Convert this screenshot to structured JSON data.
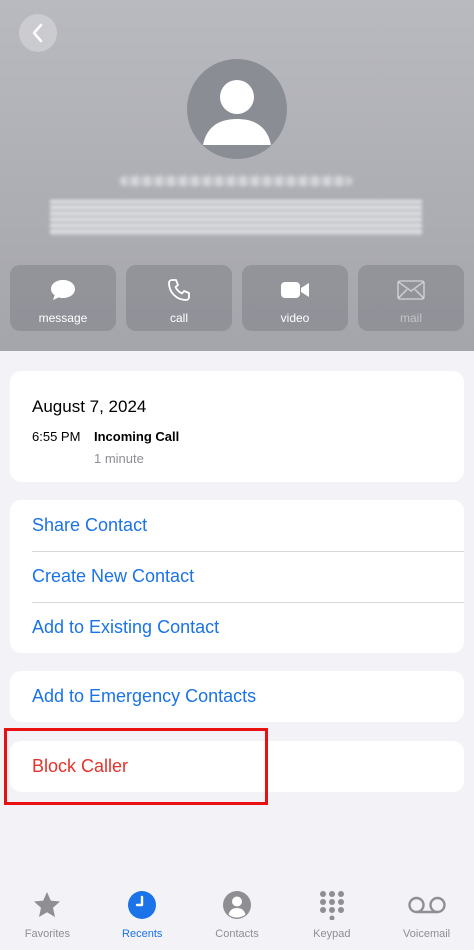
{
  "header": {
    "back_icon": "chevron-left-icon",
    "avatar_icon": "person-silhouette-icon"
  },
  "actions": [
    {
      "label": "message",
      "icon": "message-bubble-icon",
      "enabled": true
    },
    {
      "label": "call",
      "icon": "phone-icon",
      "enabled": true
    },
    {
      "label": "video",
      "icon": "video-camera-icon",
      "enabled": true
    },
    {
      "label": "mail",
      "icon": "envelope-icon",
      "enabled": false
    }
  ],
  "call_log": {
    "date": "August 7, 2024",
    "time": "6:55 PM",
    "type": "Incoming Call",
    "duration": "1 minute"
  },
  "contact_options": {
    "share": "Share Contact",
    "create": "Create New Contact",
    "add_existing": "Add to Existing Contact"
  },
  "emergency": {
    "label": "Add to Emergency Contacts"
  },
  "block": {
    "label": "Block Caller"
  },
  "tabs": [
    {
      "label": "Favorites",
      "icon": "star-icon",
      "active": false
    },
    {
      "label": "Recents",
      "icon": "clock-icon",
      "active": true
    },
    {
      "label": "Contacts",
      "icon": "person-circle-icon",
      "active": false
    },
    {
      "label": "Keypad",
      "icon": "keypad-icon",
      "active": false
    },
    {
      "label": "Voicemail",
      "icon": "voicemail-icon",
      "active": false
    }
  ],
  "colors": {
    "accent": "#1a73e8",
    "destructive": "#e5322b",
    "highlight": "#e81010",
    "background": "#f2f2f7"
  }
}
